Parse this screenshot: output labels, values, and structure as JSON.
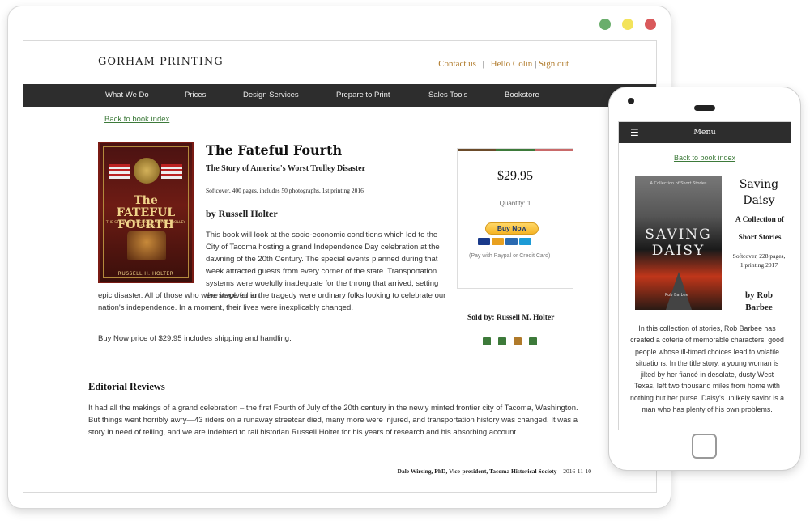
{
  "browser": {
    "window_dots": [
      "#6aae6c",
      "#f3e35b",
      "#d9595b"
    ]
  },
  "site": {
    "brand": "GORHAM PRINTING",
    "top_links": {
      "contact": "Contact us",
      "separator": "|",
      "hello": "Hello Colin",
      "pipe": "|",
      "signout": "Sign out"
    },
    "nav": [
      "What We Do",
      "Prices",
      "Design Services",
      "Prepare to Print",
      "Sales Tools",
      "Bookstore"
    ],
    "back_link": "Back to book index"
  },
  "book": {
    "cover": {
      "title_line1": "The",
      "title_line2": "FATEFUL FOURTH",
      "subtitle": "THE STORY OF AMERICA'S WORST TROLLEY DISASTER",
      "author": "RUSSELL H. HOLTER"
    },
    "title": "The Fateful Fourth",
    "subtitle": "The Story of America's Worst Trolley Disaster",
    "meta": "Softcover, 400 pages, includes 50 photographs, 1st printing 2016",
    "author": "by Russell Holter",
    "description_right": "This book will look at the socio-economic conditions which led to the City of Tacoma hosting a grand Independence Day celebration at the dawning of the 20th Century. The special events planned during that week attracted guests from every corner of the state. Transportation systems were woefully inadequate for the throng that arrived, setting the stage for an",
    "description_full": "epic disaster. All of those who were involved in the tragedy were ordinary folks looking to celebrate our nation's independence. In a moment, their lives were inexplicably changed.",
    "buy_note": "Buy Now price of $29.95 includes shipping and handling."
  },
  "purchase": {
    "top_bar_colors": [
      "#6b4b2a",
      "#3d7a3a",
      "#c96a6a"
    ],
    "price": "$29.95",
    "quantity": "Quantity: 1",
    "buy_button": "Buy Now",
    "card_colors": [
      "#1a3a8a",
      "#e8a020",
      "#2a6ab0",
      "#1d9bd6"
    ],
    "paypal_note": "(Pay with Paypal or Credit Card)",
    "sold_by": "Sold by: Russell M. Holter",
    "share_icons": [
      "facebook-icon",
      "twitter-icon",
      "email-icon",
      "computer-icon"
    ],
    "share_color": "#3d7a3a",
    "email_color": "#b07a2a"
  },
  "reviews": {
    "heading": "Editorial Reviews",
    "text": "It had all the makings of a grand celebration – the first Fourth of July of the 20th century in the newly minted frontier city of Tacoma, Washington. But things went horribly awry—43 riders on a runaway streetcar died, many more were injured, and transportation history was changed. It was a story in need of telling, and we are indebted to rail historian Russell Holter for his years of research and his absorbing account.",
    "credit": "— Dale Wirsing, PhD, Vice-president, Tacoma Historical Society",
    "date": "2016-11-10"
  },
  "phone": {
    "menu_icon": "☰",
    "menu_label": "Menu",
    "back_link": "Back to book index",
    "cover": {
      "top": "A Collection of Short Stories",
      "title": "SAVING DAISY",
      "author": "Rob Barbee"
    },
    "title": "Saving Daisy",
    "subtitle": "A Collection of Short Stories",
    "meta": "Softcover, 228 pages, 1 printing 2017",
    "author": "by Rob Barbee",
    "description": "In this collection of stories, Rob Barbee has created a coterie of memorable characters: good people whose ill-timed choices lead to volatile situations. In the title story, a young woman is jilted by her fiancé in desolate, dusty West Texas, left two thousand miles from home with nothing but her purse. Daisy's unlikely savior is a man who has plenty of his own problems."
  }
}
